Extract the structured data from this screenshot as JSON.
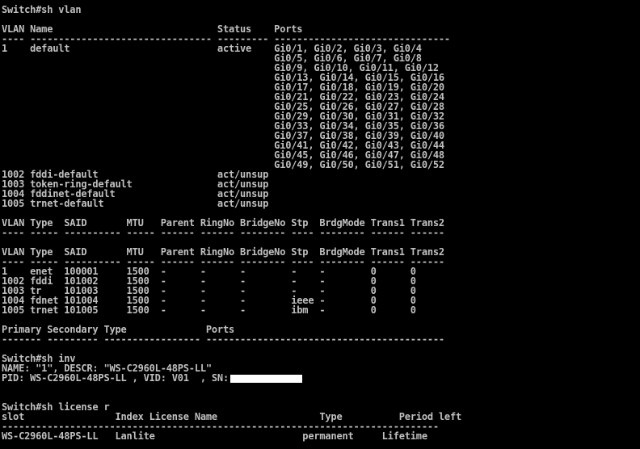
{
  "terminal": {
    "lines": [
      "Switch#sh vlan",
      "",
      "VLAN Name                             Status    Ports",
      "---- -------------------------------- --------- -------------------------------",
      "1    default                          active    Gi0/1, Gi0/2, Gi0/3, Gi0/4",
      "                                                Gi0/5, Gi0/6, Gi0/7, Gi0/8",
      "                                                Gi0/9, Gi0/10, Gi0/11, Gi0/12",
      "                                                Gi0/13, Gi0/14, Gi0/15, Gi0/16",
      "                                                Gi0/17, Gi0/18, Gi0/19, Gi0/20",
      "                                                Gi0/21, Gi0/22, Gi0/23, Gi0/24",
      "                                                Gi0/25, Gi0/26, Gi0/27, Gi0/28",
      "                                                Gi0/29, Gi0/30, Gi0/31, Gi0/32",
      "                                                Gi0/33, Gi0/34, Gi0/35, Gi0/36",
      "                                                Gi0/37, Gi0/38, Gi0/39, Gi0/40",
      "                                                Gi0/41, Gi0/42, Gi0/43, Gi0/44",
      "                                                Gi0/45, Gi0/46, Gi0/47, Gi0/48",
      "                                                Gi0/49, Gi0/50, Gi0/51, Gi0/52",
      "1002 fddi-default                     act/unsup",
      "1003 token-ring-default               act/unsup",
      "1004 fddinet-default                  act/unsup",
      "1005 trnet-default                    act/unsup",
      "",
      "VLAN Type  SAID       MTU   Parent RingNo BridgeNo Stp  BrdgMode Trans1 Trans2",
      "---- ----- ---------- ----- ------ ------ -------- ---- -------- ------ ------",
      "",
      "VLAN Type  SAID       MTU   Parent RingNo BridgeNo Stp  BrdgMode Trans1 Trans2",
      "---- ----- ---------- ----- ------ ------ -------- ---- -------- ------ ------",
      "1    enet  100001     1500  -      -      -        -    -        0      0",
      "1002 fddi  101002     1500  -      -      -        -    -        0      0",
      "1003 tr    101003     1500  -      -      -        -    -        0      0",
      "1004 fdnet 101004     1500  -      -      -        ieee -        0      0",
      "1005 trnet 101005     1500  -      -      -        ibm  -        0      0",
      "",
      "Primary Secondary Type              Ports",
      "------- --------- ----------------- ------------------------------------------",
      "",
      "Switch#sh inv",
      "NAME: \"1\", DESCR: \"WS-C2960L-48PS-LL\"",
      "PID: WS-C2960L-48PS-LL , VID: V01  , SN:",
      "",
      "",
      "Switch#sh license r",
      "slot                Index License Name                  Type          Period left",
      "-----------------------------------------------------------------------------",
      "WS-C2960L-48PS-LL   Lanlite                          permanent     Lifetime"
    ],
    "colors": {
      "background": "#000000",
      "text": "#c0c0c0",
      "redaction": "#ffffff"
    }
  }
}
